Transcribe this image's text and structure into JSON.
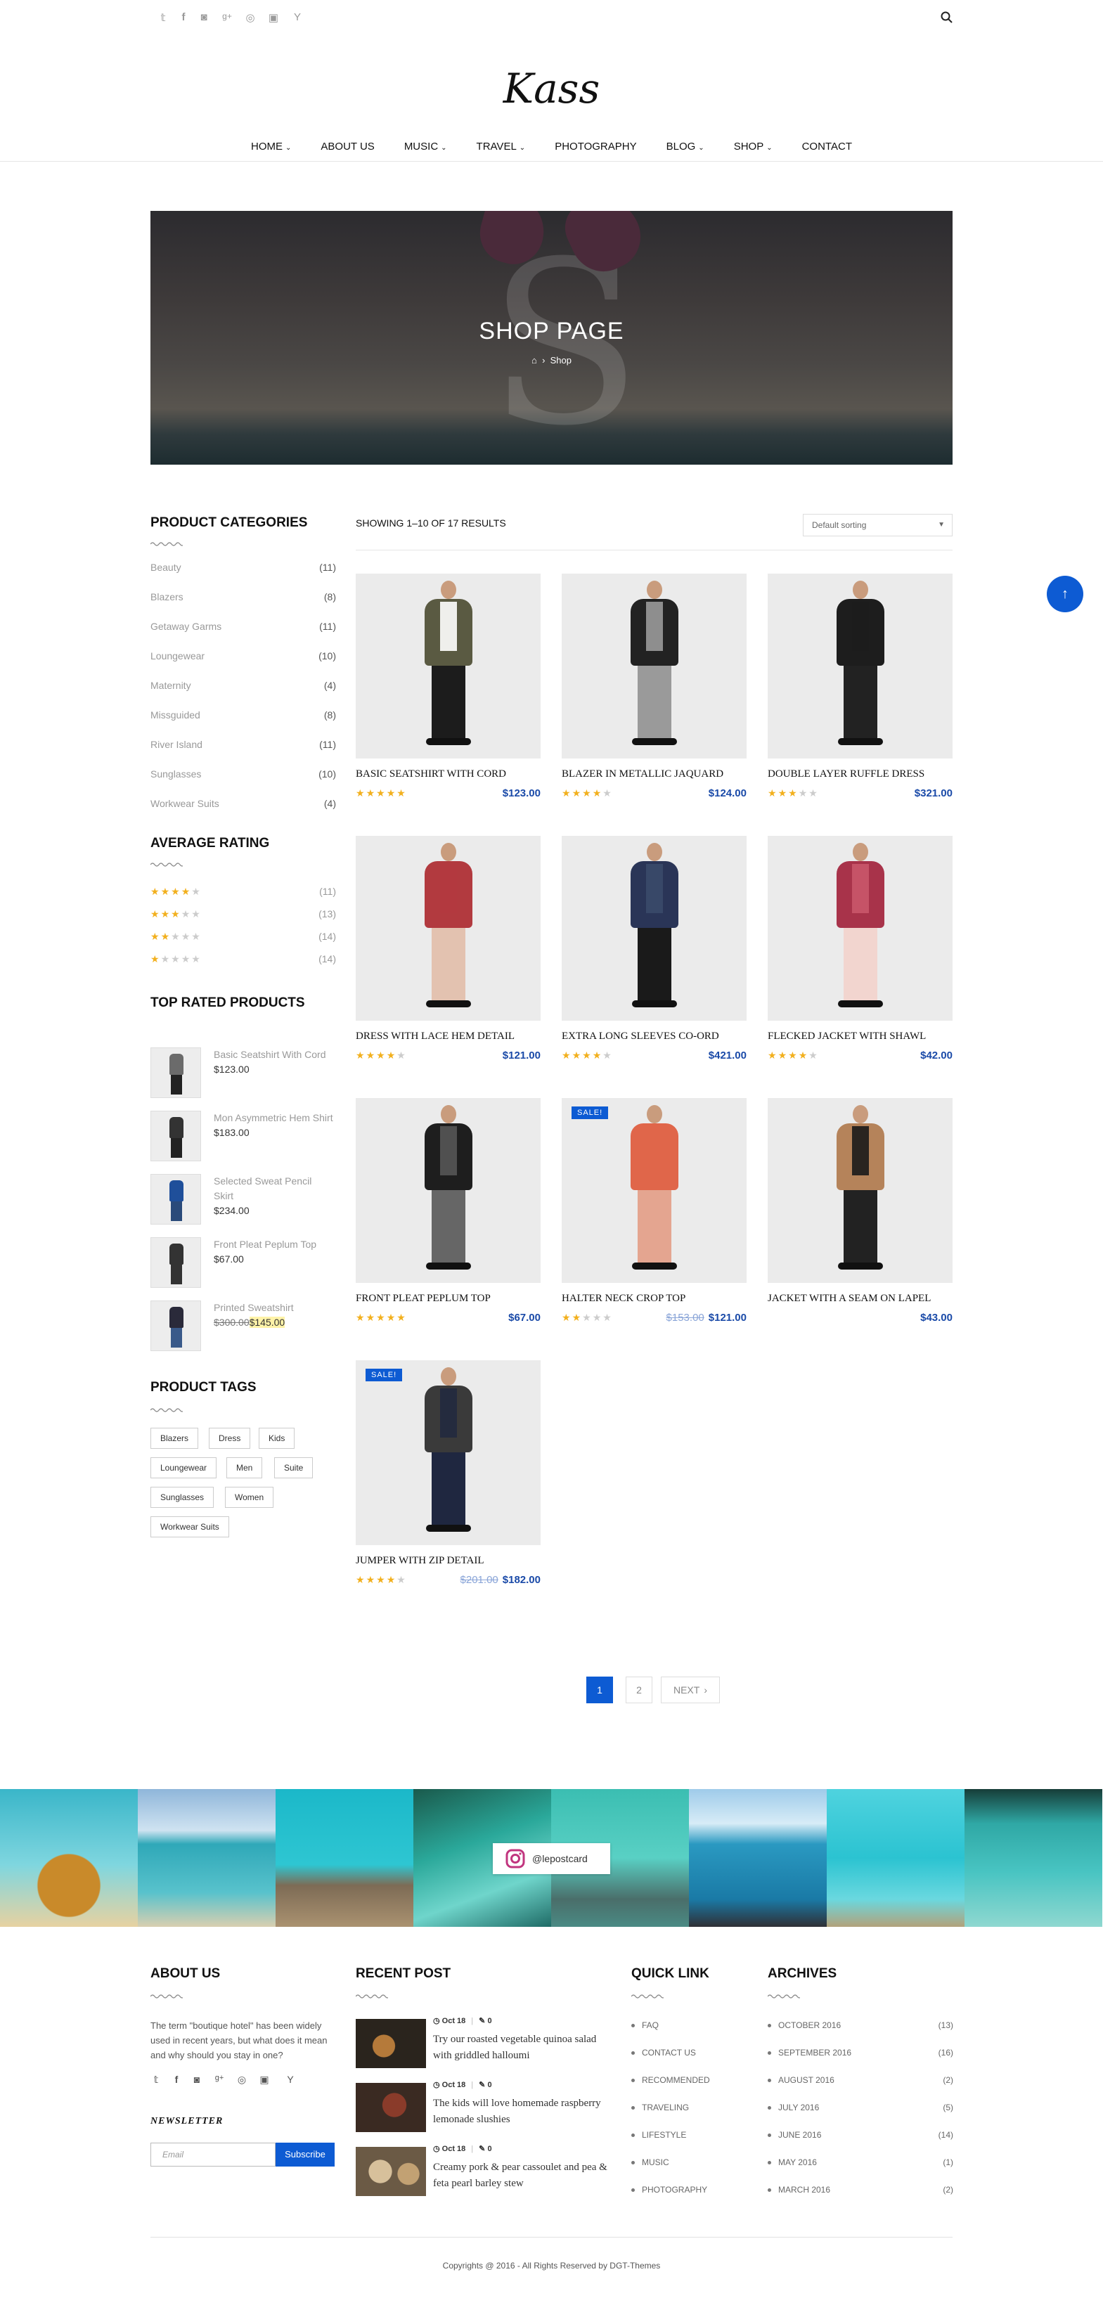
{
  "header": {
    "social_icons": [
      "twitter-icon",
      "facebook-icon",
      "instagram-icon",
      "google-plus-icon",
      "dribbble-icon",
      "youtube-icon",
      "yc-icon"
    ],
    "logo": "Kass",
    "nav": [
      {
        "label": "HOME",
        "dropdown": true
      },
      {
        "label": "ABOUT US",
        "dropdown": false
      },
      {
        "label": "MUSIC",
        "dropdown": true
      },
      {
        "label": "TRAVEL",
        "dropdown": true
      },
      {
        "label": "PHOTOGRAPHY",
        "dropdown": false
      },
      {
        "label": "BLOG",
        "dropdown": true
      },
      {
        "label": "SHOP",
        "dropdown": true
      },
      {
        "label": "CONTACT",
        "dropdown": false
      }
    ]
  },
  "hero": {
    "title": "SHOP PAGE",
    "breadcrumb": "Shop",
    "letter": "S"
  },
  "sidebar": {
    "categories_title": "PRODUCT CATEGORIES",
    "categories": [
      {
        "name": "Beauty",
        "count": "(11)"
      },
      {
        "name": "Blazers",
        "count": "(8)"
      },
      {
        "name": "Getaway Garms",
        "count": "(11)"
      },
      {
        "name": "Loungewear",
        "count": "(10)"
      },
      {
        "name": "Maternity",
        "count": "(4)"
      },
      {
        "name": "Missguided",
        "count": "(8)"
      },
      {
        "name": "River Island",
        "count": "(11)"
      },
      {
        "name": "Sunglasses",
        "count": "(10)"
      },
      {
        "name": "Workwear Suits",
        "count": "(4)"
      }
    ],
    "rating_title": "AVERAGE RATING",
    "ratings": [
      {
        "stars": 4,
        "count": "(11)"
      },
      {
        "stars": 3,
        "count": "(13)"
      },
      {
        "stars": 2,
        "count": "(14)"
      },
      {
        "stars": 1,
        "count": "(14)"
      }
    ],
    "top_rated_title": "TOP RATED PRODUCTS",
    "top_rated": [
      {
        "name": "Basic Seatshirt With Cord",
        "price": "$123.00",
        "old": ""
      },
      {
        "name": "Mon Asymmetric Hem Shirt",
        "price": "$183.00",
        "old": ""
      },
      {
        "name": "Selected Sweat Pencil Skirt",
        "price": "$234.00",
        "old": ""
      },
      {
        "name": "Front Pleat Peplum Top",
        "price": "$67.00",
        "old": ""
      },
      {
        "name": "Printed Sweatshirt",
        "price": "$145.00",
        "old": "$300.00"
      }
    ],
    "tags_title": "PRODUCT TAGS",
    "tags": [
      "Blazers",
      "Dress",
      "Kids",
      "Loungewear",
      "Men",
      "Suite",
      "Sunglasses",
      "Women",
      "Workwear Suits"
    ]
  },
  "shop": {
    "showing": "SHOWING 1–10 OF 17 RESULTS",
    "sort": "Default sorting",
    "products": [
      {
        "name": "BASIC SEATSHIRT WITH CORD",
        "stars": 5,
        "price": "$123.00",
        "old": "",
        "sale": false,
        "colors": [
          "#5a5a42",
          "#fff",
          "#1c1c1c"
        ]
      },
      {
        "name": "BLAZER IN METALLIC JAQUARD",
        "stars": 4,
        "price": "$124.00",
        "old": "",
        "sale": false,
        "colors": [
          "#222",
          "#9a9a9a",
          "#9a9a9a"
        ]
      },
      {
        "name": "DOUBLE LAYER RUFFLE DRESS",
        "stars": 3,
        "price": "$321.00",
        "old": "",
        "sale": false,
        "colors": [
          "#1d1d1d",
          "#1d1d1d",
          "#222"
        ]
      },
      {
        "name": "DRESS WITH LACE HEM DETAIL",
        "stars": 4,
        "price": "$121.00",
        "old": "",
        "sale": false,
        "colors": [
          "#b23a3f",
          "#b23a3f",
          "#e3c2b0"
        ]
      },
      {
        "name": "EXTRA LONG SLEEVES CO-ORD",
        "stars": 4,
        "price": "$421.00",
        "old": "",
        "sale": false,
        "colors": [
          "#2a3557",
          "#3a4a6a",
          "#1a1a1a"
        ]
      },
      {
        "name": "FLECKED JACKET WITH SHAWL",
        "stars": 4,
        "price": "$42.00",
        "old": "",
        "sale": false,
        "colors": [
          "#a8334a",
          "#c9566a",
          "#f2d5cf"
        ]
      },
      {
        "name": "FRONT PLEAT PEPLUM TOP",
        "stars": 5,
        "price": "$67.00",
        "old": "",
        "sale": false,
        "colors": [
          "#1e1e1e",
          "#555",
          "#666"
        ]
      },
      {
        "name": "HALTER NECK CROP TOP",
        "stars": 2,
        "price": "$121.00",
        "old": "$153.00",
        "sale": true,
        "sale_label": "SALE!",
        "colors": [
          "#e0664a",
          "#e0664a",
          "#e4a590"
        ]
      },
      {
        "name": "JACKET WITH A SEAM ON LAPEL",
        "stars": 0,
        "price": "$43.00",
        "old": "",
        "sale": false,
        "colors": [
          "#b5835a",
          "#1a1a1a",
          "#222"
        ]
      },
      {
        "name": "JUMPER WITH ZIP DETAIL",
        "stars": 4,
        "price": "$182.00",
        "old": "$201.00",
        "sale": true,
        "sale_label": "SALE!",
        "colors": [
          "#3a3a3a",
          "#222a3f",
          "#1f2740"
        ]
      }
    ],
    "pagination": [
      "1",
      "2",
      "NEXT"
    ]
  },
  "instagram": {
    "handle": "@lepostcard"
  },
  "footer": {
    "about_title": "ABOUT US",
    "about_text": "The term \"boutique hotel\" has been widely used in recent years, but what does it mean and why should you stay in one?",
    "social_icons": [
      "twitter-icon",
      "facebook-icon",
      "instagram-icon",
      "google-plus-icon",
      "dribbble-icon",
      "youtube-icon",
      "yc-icon"
    ],
    "newsletter_title": "NEWSLETTER",
    "newsletter_placeholder": "Email",
    "newsletter_button": "Subscribe",
    "recent_title": "RECENT POST",
    "recent": [
      {
        "date": "Oct 18",
        "comments": "0",
        "title": "Try our roasted vegetable quinoa salad with griddled halloumi"
      },
      {
        "date": "Oct 18",
        "comments": "0",
        "title": "The kids will love homemade raspberry lemonade slushies"
      },
      {
        "date": "Oct 18",
        "comments": "0",
        "title": "Creamy pork & pear cassoulet and pea & feta pearl barley stew"
      }
    ],
    "quick_title": "QUICK LINK",
    "quick": [
      "FAQ",
      "CONTACT US",
      "RECOMMENDED",
      "TRAVELING",
      "LIFESTYLE",
      "MUSIC",
      "PHOTOGRAPHY"
    ],
    "archives_title": "ARCHIVES",
    "archives": [
      {
        "label": "OCTOBER 2016",
        "count": "(13)"
      },
      {
        "label": "SEPTEMBER 2016",
        "count": "(16)"
      },
      {
        "label": "AUGUST 2016",
        "count": "(2)"
      },
      {
        "label": "JULY 2016",
        "count": "(5)"
      },
      {
        "label": "JUNE 2016",
        "count": "(14)"
      },
      {
        "label": "MAY 2016",
        "count": "(1)"
      },
      {
        "label": "MARCH 2016",
        "count": "(2)"
      }
    ],
    "copyright": "Copyrights @ 2016 - All Rights Reserved by DGT-Themes"
  },
  "colors": {
    "accent": "#0d5bd3",
    "star": "#f2b01e",
    "price": "#1a4aa8"
  }
}
